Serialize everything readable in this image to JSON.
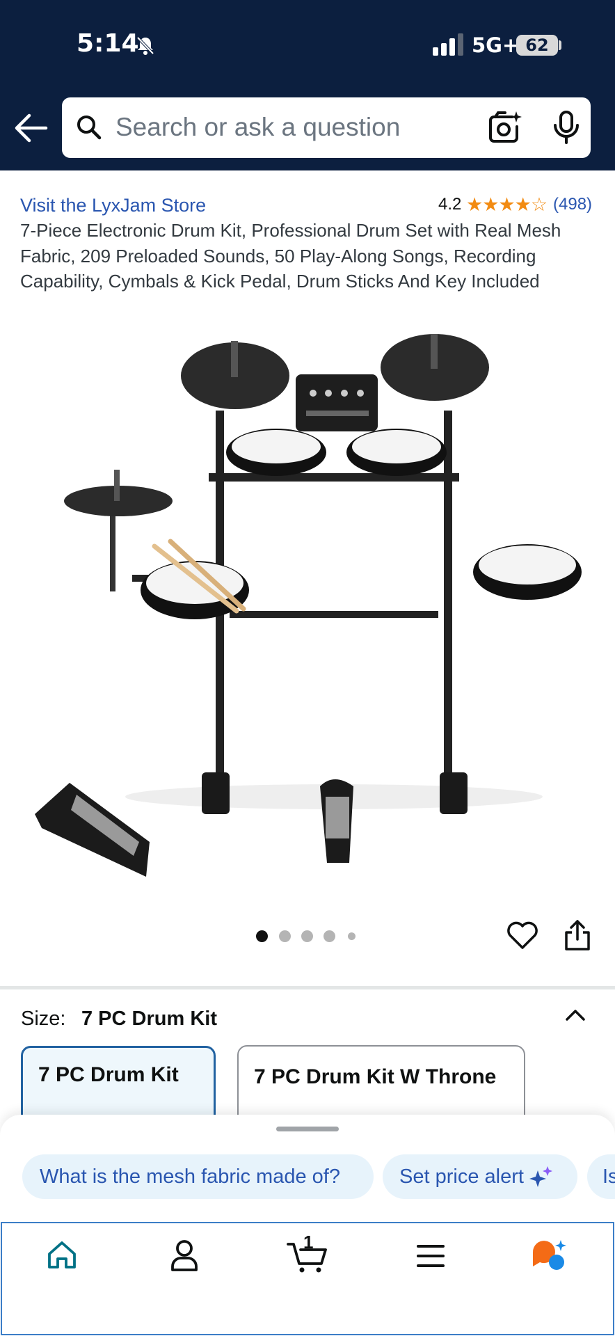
{
  "status_bar": {
    "time": "5:14",
    "network": "5G+",
    "battery": "62"
  },
  "search": {
    "placeholder": "Search or ask a question"
  },
  "product": {
    "store_link": "Visit the LyxJam Store",
    "rating": "4.2",
    "stars": "★★★★☆",
    "review_count": "(498)",
    "title": "7-Piece Electronic Drum Kit, Professional Drum Set with Real Mesh Fabric, 209 Preloaded Sounds, 50 Play-Along Songs, Recording Capability, Cymbals & Kick Pedal, Drum Sticks And Key Included",
    "image_label": "electronic drum kit product photo",
    "image_count": 5,
    "current_image": 1
  },
  "size": {
    "label": "Size:",
    "selected": "7 PC Drum Kit",
    "options": [
      "7 PC Drum Kit",
      "7 PC Drum Kit W Throne"
    ]
  },
  "suggestions": [
    "What is the mesh fabric made of?",
    "Set price alert",
    "Is"
  ],
  "cart": {
    "count": "1"
  },
  "colors": {
    "header": "#0c1f3f",
    "link": "#2a56b0",
    "star": "#f28b12",
    "selected_border": "#2162a1"
  },
  "icons": [
    "back-arrow-icon",
    "search-icon",
    "camera-icon",
    "microphone-icon",
    "heart-icon",
    "share-icon",
    "chevron-up-icon",
    "home-icon",
    "account-icon",
    "cart-icon",
    "menu-icon",
    "rufus-icon",
    "sparkle-icon"
  ]
}
